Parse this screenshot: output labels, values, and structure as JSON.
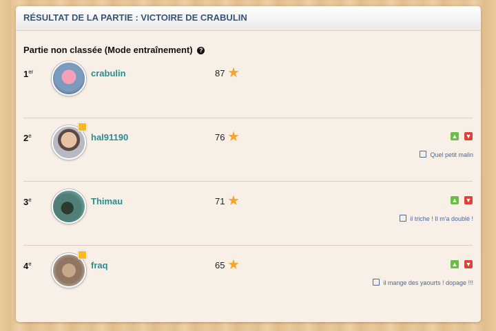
{
  "header": {
    "title": "RÉSULTAT DE LA PARTIE : VICTOIRE DE CRABULIN"
  },
  "subtitle": {
    "text": "Partie non classée (Mode entraînement)",
    "help_icon": "help-circle-icon"
  },
  "colors": {
    "header_text": "#37537a",
    "player_name": "#2b8c8f",
    "star": "#f5a52a",
    "thumb_up": "#6cbd45",
    "thumb_down": "#d9433a",
    "comment": "#4c6a96"
  },
  "players": [
    {
      "rank": "1",
      "rank_suffix": "er",
      "name": "crabulin",
      "score": "87",
      "badge": false,
      "comment": ""
    },
    {
      "rank": "2",
      "rank_suffix": "e",
      "name": "hal91190",
      "score": "76",
      "badge": true,
      "comment": "Quel petit malin"
    },
    {
      "rank": "3",
      "rank_suffix": "e",
      "name": "Thimau",
      "score": "71",
      "badge": false,
      "comment": "il triche ! Il m'a doublé !"
    },
    {
      "rank": "4",
      "rank_suffix": "e",
      "name": "fraq",
      "score": "65",
      "badge": true,
      "comment": "il mange des yaourts ! dopage !!!"
    }
  ]
}
